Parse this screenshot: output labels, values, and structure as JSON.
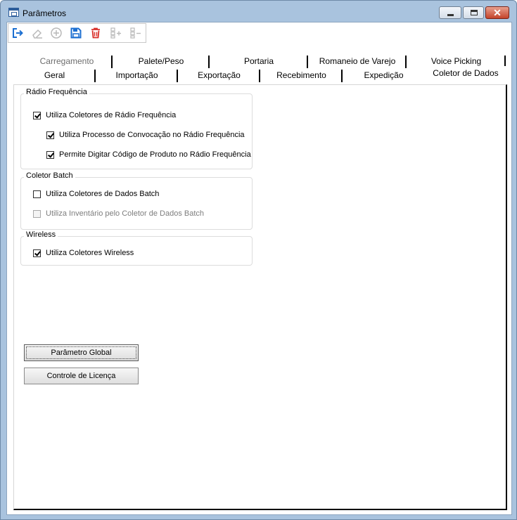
{
  "window": {
    "title": "Parâmetros",
    "close_glyph": "✕"
  },
  "toolbar": {
    "buttons": [
      {
        "icon": "exit-icon",
        "enabled": true
      },
      {
        "icon": "eraser-icon",
        "enabled": false
      },
      {
        "icon": "add-circle-icon",
        "enabled": false
      },
      {
        "icon": "save-icon",
        "enabled": true
      },
      {
        "icon": "delete-icon",
        "enabled": true
      },
      {
        "icon": "add-row-icon",
        "enabled": false
      },
      {
        "icon": "remove-row-icon",
        "enabled": false
      }
    ]
  },
  "tabs": {
    "row1": [
      "Carregamento",
      "Palete/Peso",
      "Portaria",
      "Romaneio de Varejo",
      "Voice Picking"
    ],
    "row2": [
      "Geral",
      "Importação",
      "Exportação",
      "Recebimento",
      "Expedição",
      "Coletor de Dados"
    ],
    "active": "Coletor de Dados",
    "disabled": [
      "Carregamento"
    ]
  },
  "groups": {
    "radio": {
      "title": "Rádio Frequência",
      "items": [
        {
          "label": "Utiliza Coletores de Rádio Frequência",
          "checked": true,
          "enabled": true
        },
        {
          "label": "Utiliza Processo de Convocação no Rádio Frequência",
          "checked": true,
          "enabled": true
        },
        {
          "label": "Permite Digitar Código de Produto no Rádio Frequência",
          "checked": true,
          "enabled": true
        }
      ]
    },
    "batch": {
      "title": "Coletor Batch",
      "items": [
        {
          "label": "Utiliza Coletores de Dados Batch",
          "checked": false,
          "enabled": true
        },
        {
          "label": "Utiliza Inventário pelo Coletor de Dados Batch",
          "checked": false,
          "enabled": false
        }
      ]
    },
    "wireless": {
      "title": "Wireless",
      "items": [
        {
          "label": "Utiliza Coletores Wireless",
          "checked": true,
          "enabled": true
        }
      ]
    }
  },
  "buttons": {
    "global": "Parâmetro Global",
    "license": "Controle de Licença"
  },
  "colors": {
    "icon_blue": "#1c6fd1",
    "icon_red": "#d9302a",
    "icon_disabled": "#b9b9b9"
  }
}
